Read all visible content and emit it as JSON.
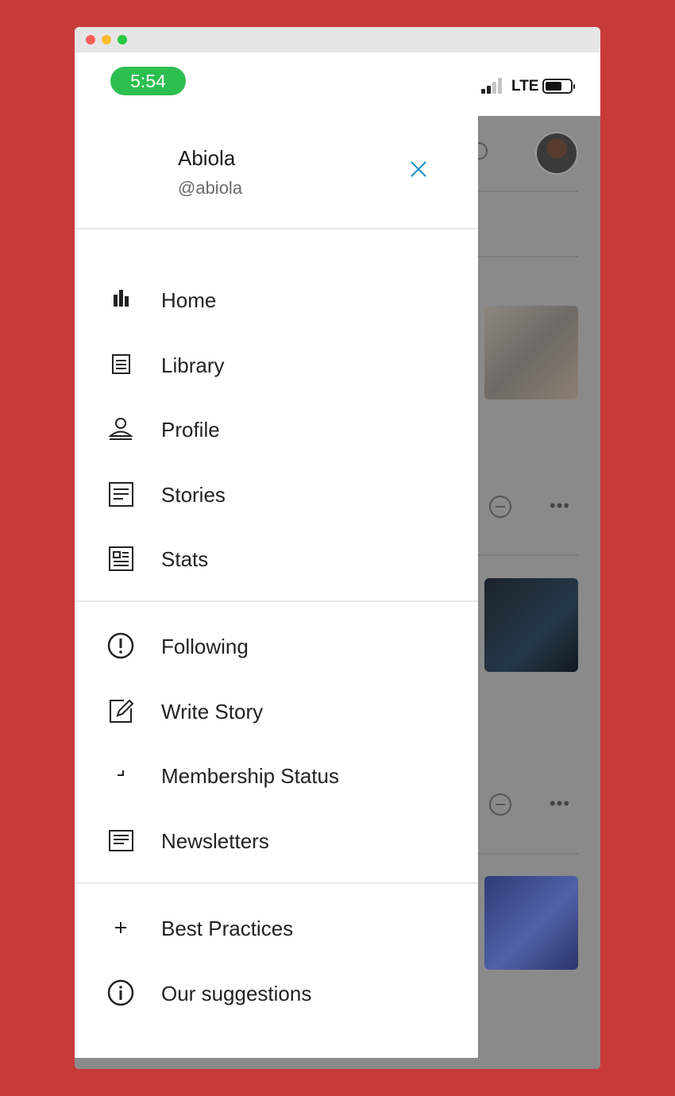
{
  "status_bar": {
    "time": "5:54",
    "network": "LTE"
  },
  "user": {
    "name": "Abiola",
    "handle": "@abiola"
  },
  "menu": {
    "primary": [
      {
        "label": "Home",
        "icon": "bar-chart-icon"
      },
      {
        "label": "Library",
        "icon": "library-icon"
      },
      {
        "label": "Profile",
        "icon": "person-icon"
      },
      {
        "label": "Stories",
        "icon": "document-icon"
      },
      {
        "label": "Stats",
        "icon": "newspaper-icon"
      }
    ],
    "secondary": [
      {
        "label": "Following",
        "icon": "alert-circle-icon"
      },
      {
        "label": "Write Story",
        "icon": "edit-icon"
      },
      {
        "label": "Membership Status",
        "icon": "corner-icon"
      },
      {
        "label": "Newsletters",
        "icon": "list-icon"
      }
    ],
    "tertiary": [
      {
        "label": "Best Practices",
        "icon": "plus-icon"
      },
      {
        "label": "Our suggestions",
        "icon": "info-icon"
      }
    ]
  },
  "background_actions": {
    "more_label": "•••"
  },
  "colors": {
    "page_bg": "#c83a3a",
    "status_pill": "#2dbe50",
    "close_icon": "#1a8bc6",
    "overlay": "#8a8a8a"
  }
}
